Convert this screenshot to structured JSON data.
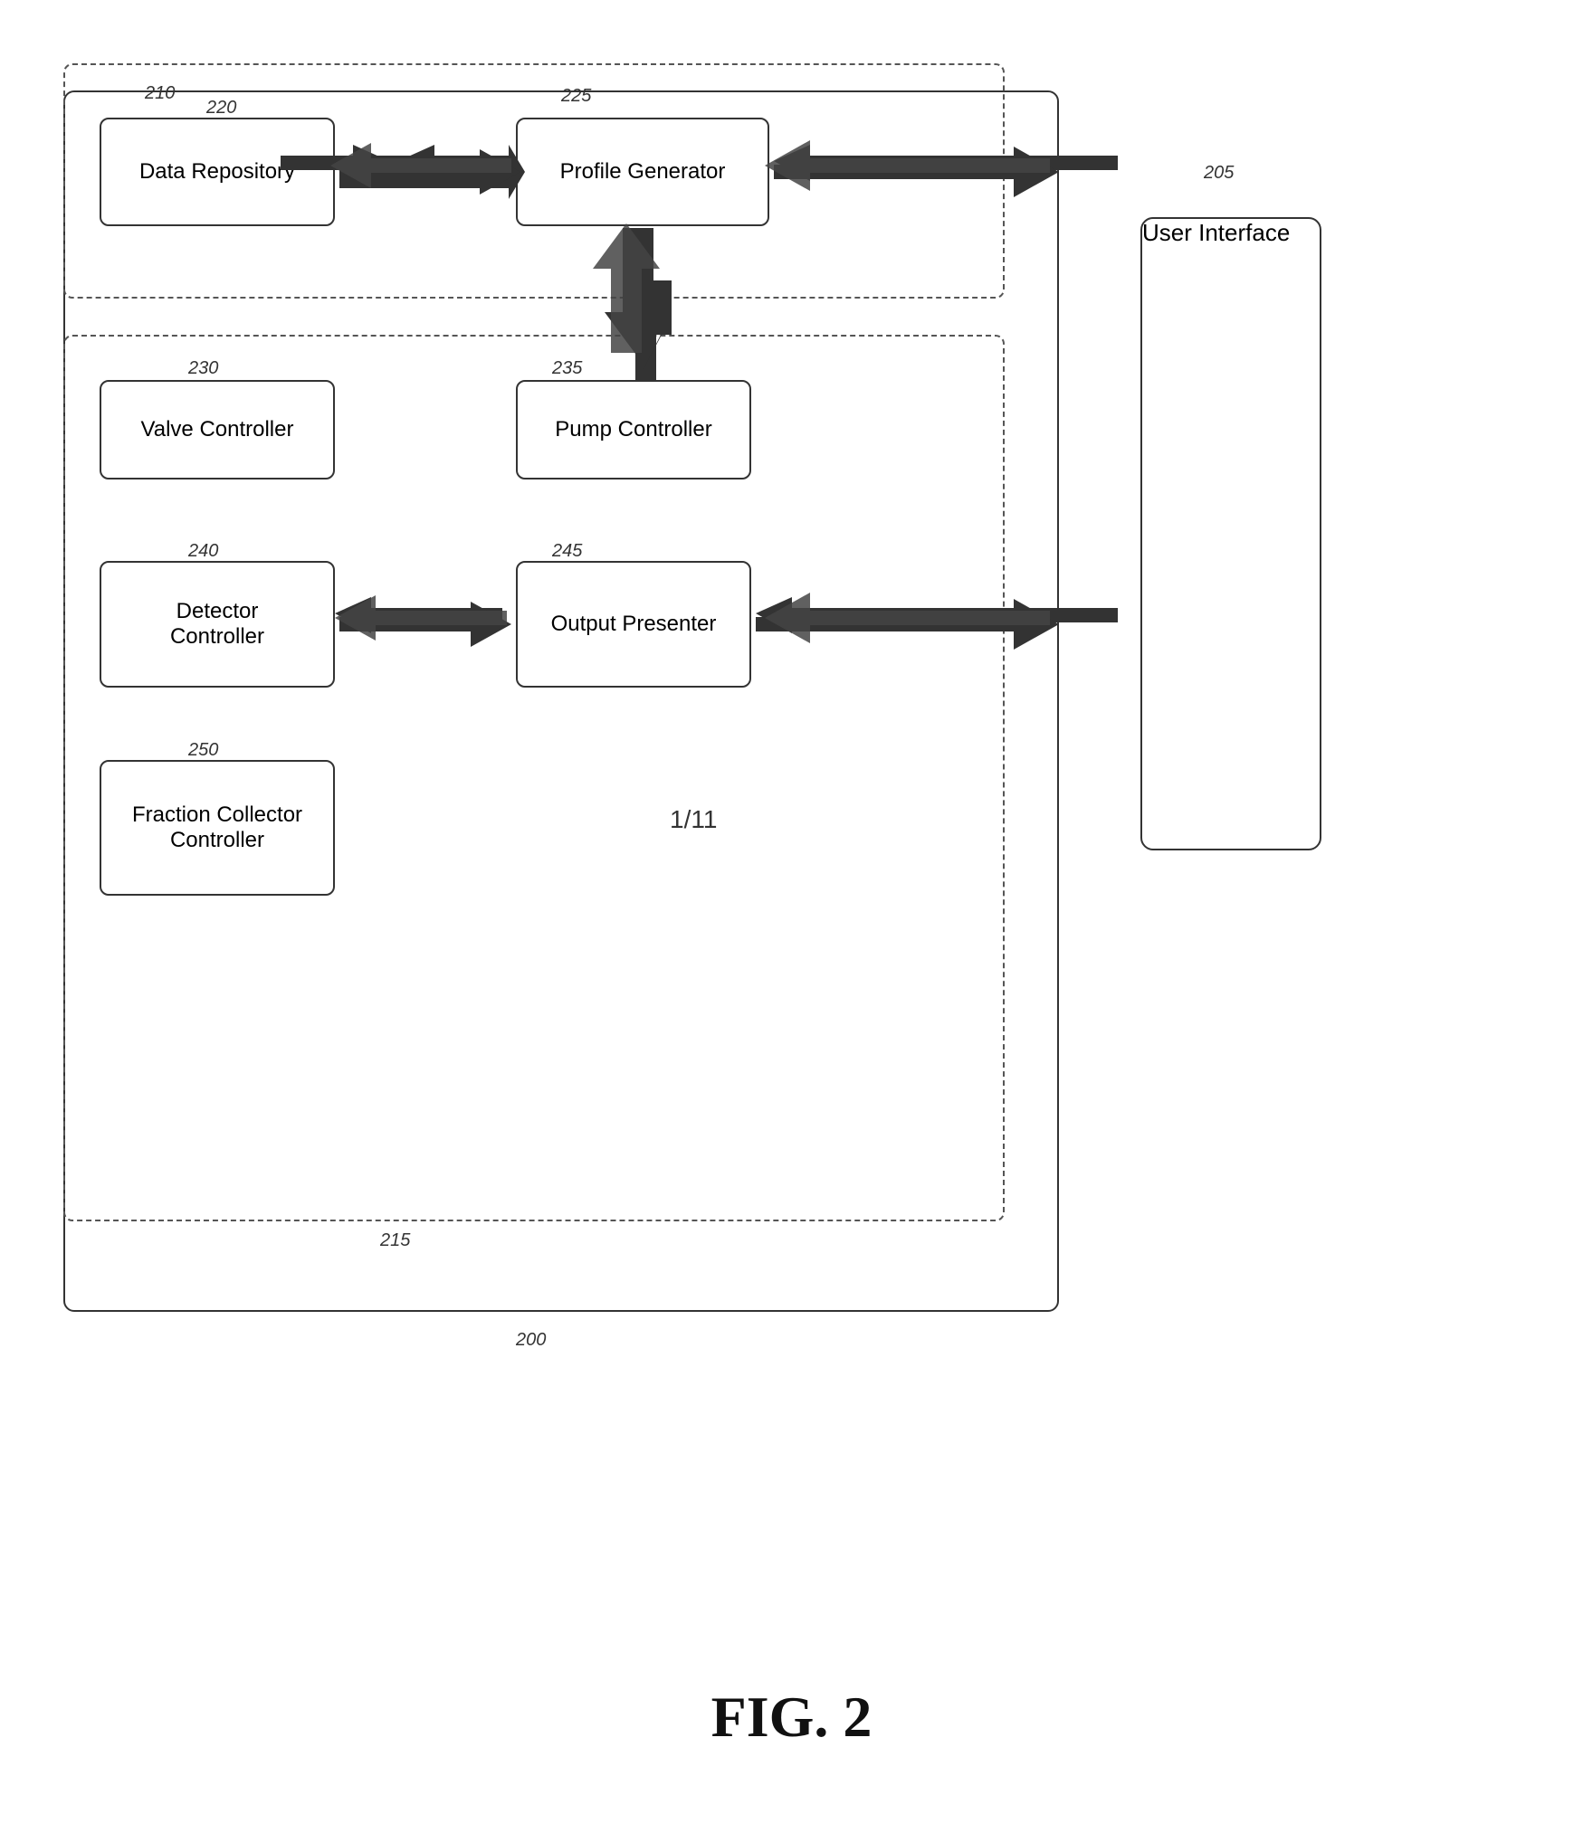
{
  "diagram": {
    "title": "FIG. 2",
    "labels": {
      "n200": "200",
      "n205": "205",
      "n210": "210",
      "n215": "215",
      "n220": "220",
      "n225": "225",
      "n230": "230",
      "n235": "235",
      "n240": "240",
      "n245": "245",
      "n250": "250"
    },
    "components": {
      "data_repository": "Data Repository",
      "profile_generator": "Profile Generator",
      "valve_controller": "Valve Controller",
      "pump_controller": "Pump Controller",
      "detector_controller": "Detector\nController",
      "output_presenter": "Output Presenter",
      "fraction_collector": "Fraction Collector\nController",
      "user_interface": "User Interface"
    },
    "page_label": "1/11"
  }
}
